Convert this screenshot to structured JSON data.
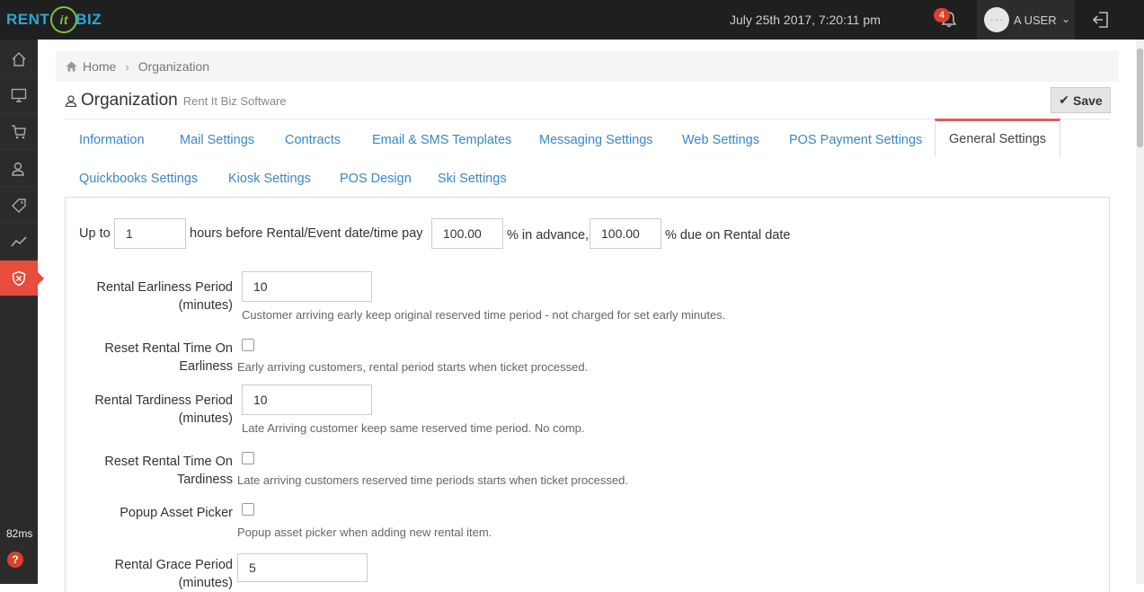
{
  "header": {
    "logo": {
      "part1": "RENT",
      "part2": "it",
      "part3": "BIZ"
    },
    "datetime": "July 25th 2017, 7:20:11 pm",
    "notifications_count": "4",
    "user_avatar_text": "- - -",
    "user_name": "A USER"
  },
  "sidebar": {
    "items": [
      {
        "icon": "home-icon"
      },
      {
        "icon": "monitor-icon"
      },
      {
        "icon": "cart-icon"
      },
      {
        "icon": "users-icon"
      },
      {
        "icon": "tag-icon"
      },
      {
        "icon": "chart-line-icon"
      },
      {
        "icon": "shield-icon",
        "active": true
      }
    ],
    "timing": "82ms",
    "help": "?"
  },
  "breadcrumb": {
    "home": "Home",
    "current": "Organization"
  },
  "page": {
    "title": "Organization",
    "subtitle": "Rent It Biz Software",
    "save_label": "Save"
  },
  "tabs": [
    {
      "label": "Information"
    },
    {
      "label": "Mail Settings"
    },
    {
      "label": "Contracts"
    },
    {
      "label": "Email & SMS Templates"
    },
    {
      "label": "Messaging Settings"
    },
    {
      "label": "Web Settings"
    },
    {
      "label": "POS Payment Settings"
    },
    {
      "label": "General Settings",
      "active": true
    },
    {
      "label": "Quickbooks Settings"
    },
    {
      "label": "Kiosk Settings"
    },
    {
      "label": "POS Design"
    },
    {
      "label": "Ski Settings"
    }
  ],
  "payment_row": {
    "prefix": "Up to",
    "hours_value": "1",
    "middle": "hours before Rental/Event date/time pay",
    "advance_value": "100.00",
    "advance_suffix": "% in advance,",
    "due_value": "100.00",
    "due_suffix": "% due on Rental date"
  },
  "fields": {
    "earliness_period": {
      "label_line1": "Rental Earliness Period",
      "label_line2": "(minutes)",
      "value": "10",
      "help": "Customer arriving early keep original reserved time period - not charged for set early minutes."
    },
    "reset_earliness": {
      "label_line1": "Reset Rental Time On",
      "label_line2": "Earliness",
      "checked": false,
      "help": "Early arriving customers, rental period starts when ticket processed."
    },
    "tardiness_period": {
      "label_line1": "Rental Tardiness Period",
      "label_line2": "(minutes)",
      "value": "10",
      "help": "Late Arriving customer keep same reserved time period. No comp."
    },
    "reset_tardiness": {
      "label_line1": "Reset Rental Time On",
      "label_line2": "Tardiness",
      "checked": false,
      "help": "Late arriving customers reserved time periods starts when ticket processed."
    },
    "popup_asset_picker": {
      "label": "Popup Asset Picker",
      "checked": false,
      "help": "Popup asset picker when adding new rental item."
    },
    "grace_period": {
      "label_line1": "Rental Grace Period",
      "label_line2": "(minutes)",
      "value": "5"
    }
  },
  "colors": {
    "accent": "#3a87c7",
    "active_sidebar": "#e74c3c",
    "topbar": "#1f1f1f"
  }
}
